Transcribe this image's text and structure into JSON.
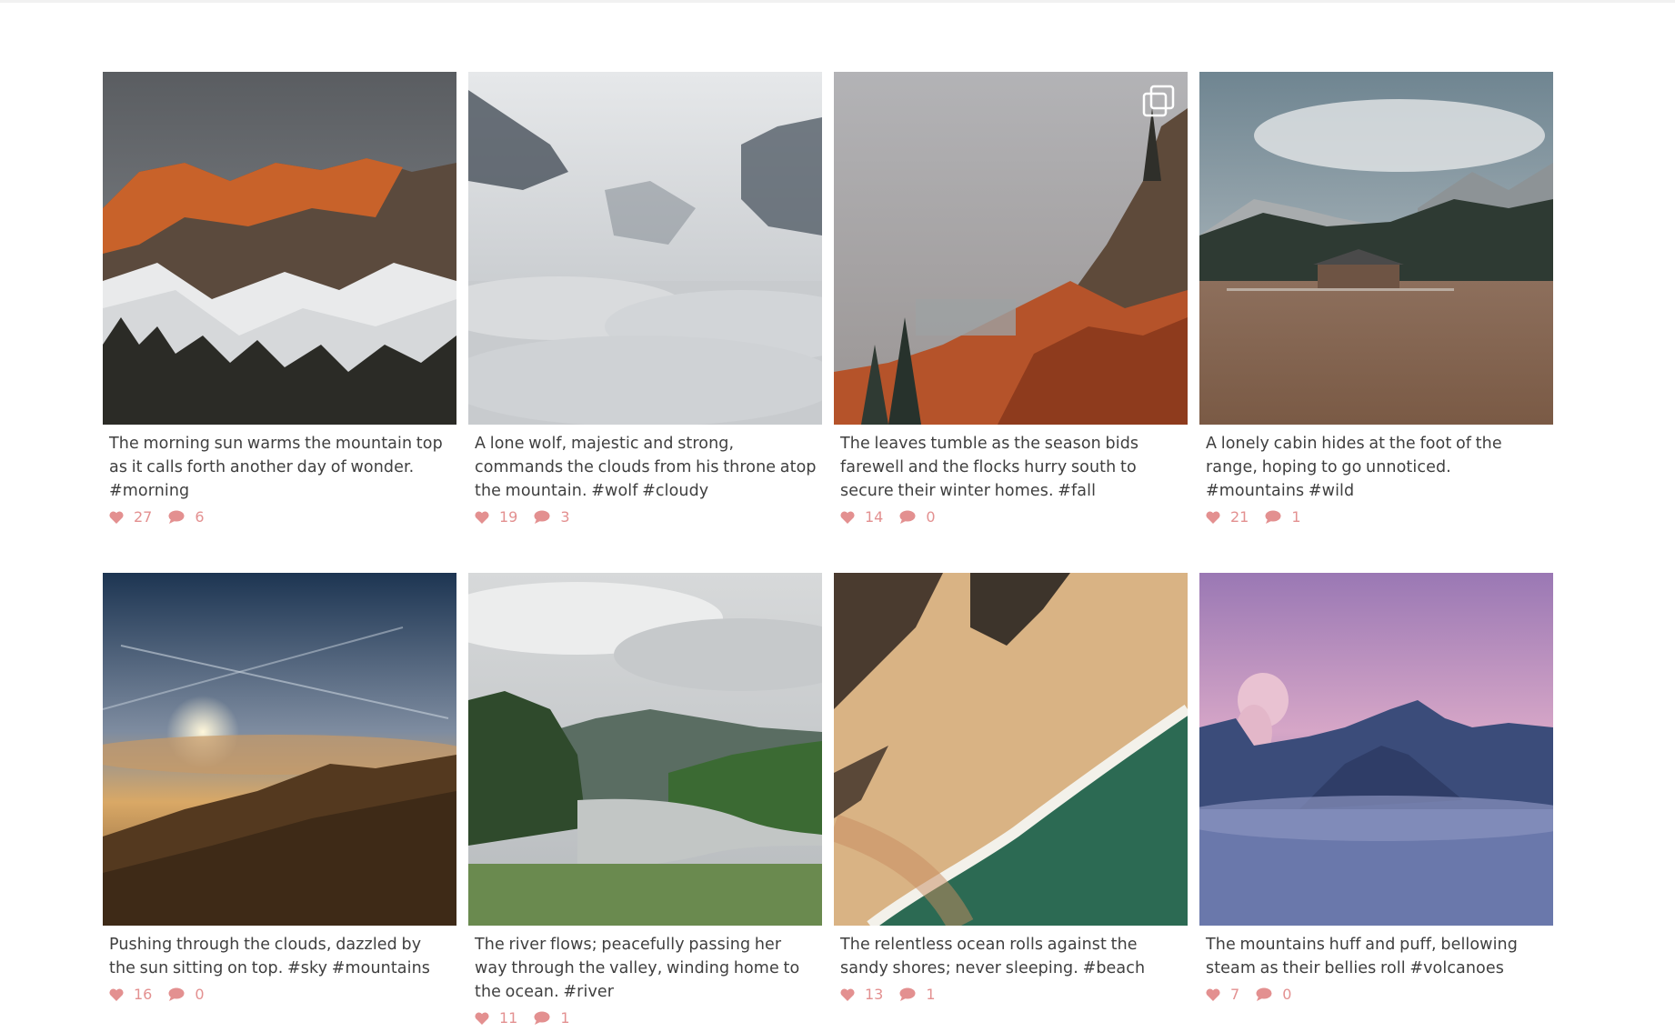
{
  "colors": {
    "accent": "#e39090",
    "text": "#3f3f3f",
    "background": "#ffffff"
  },
  "icons": {
    "like": "heart-icon",
    "comment": "comment-icon",
    "multi": "multiple-images-icon"
  },
  "posts": [
    {
      "caption": "The morning sun warms the mountain top as it calls forth another day of wonder. #morning",
      "likes": "27",
      "comments": "6",
      "multi": false
    },
    {
      "caption": "A lone wolf, majestic and strong, commands the clouds from his throne atop the mountain. #wolf #cloudy",
      "likes": "19",
      "comments": "3",
      "multi": false
    },
    {
      "caption": "The leaves tumble as the season bids farewell and the flocks hurry south to secure their winter homes. #fall",
      "likes": "14",
      "comments": "0",
      "multi": true
    },
    {
      "caption": "A lonely cabin hides at the foot of the range, hoping to go unnoticed. #mountains #wild",
      "likes": "21",
      "comments": "1",
      "multi": false
    },
    {
      "caption": "Pushing through the clouds, dazzled by the sun sitting on top. #sky #mountains",
      "likes": "16",
      "comments": "0",
      "multi": false
    },
    {
      "caption": "The river flows; peacefully passing her way through the valley, winding home to the ocean. #river",
      "likes": "11",
      "comments": "1",
      "multi": false
    },
    {
      "caption": "The relentless ocean rolls against the sandy shores; never sleeping. #beach",
      "likes": "13",
      "comments": "1",
      "multi": false
    },
    {
      "caption": "The mountains huff and puff, bellowing steam as their bellies roll #volcanoes",
      "likes": "7",
      "comments": "0",
      "multi": false
    }
  ]
}
